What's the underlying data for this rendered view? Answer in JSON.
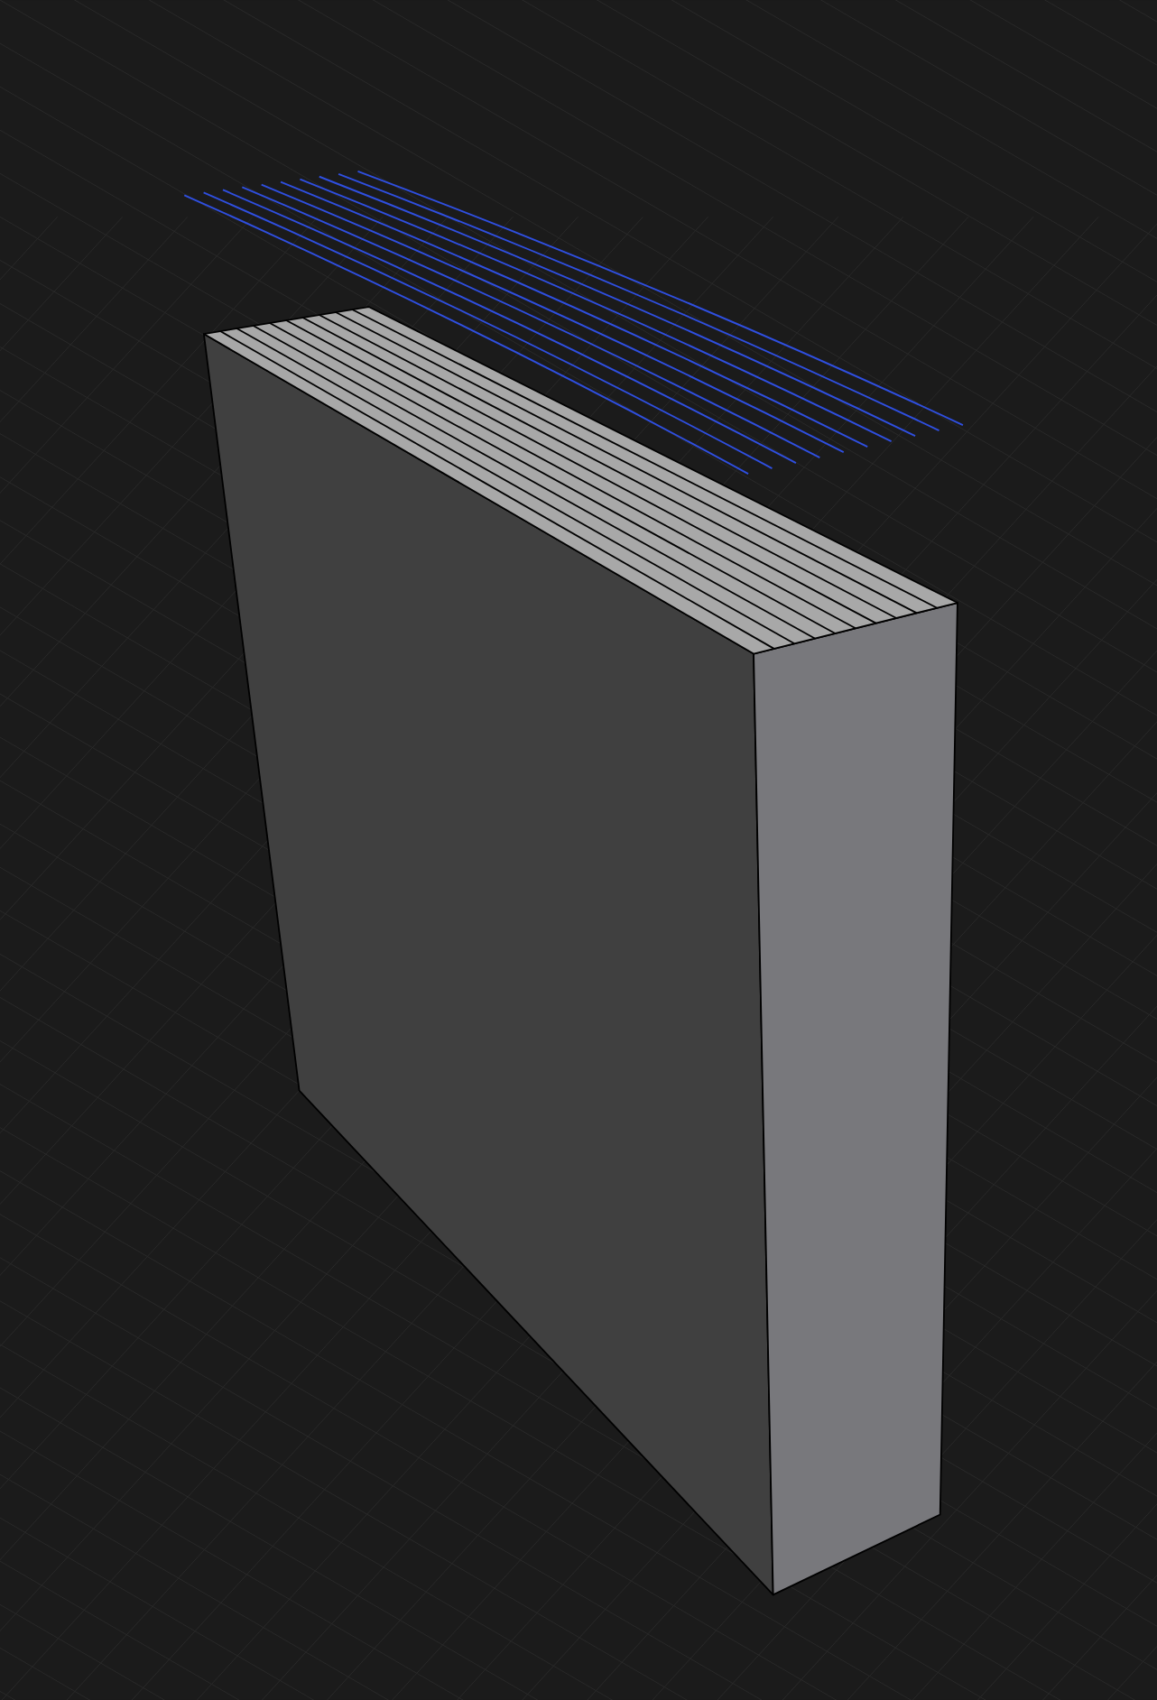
{
  "viewport": {
    "grid": true
  }
}
